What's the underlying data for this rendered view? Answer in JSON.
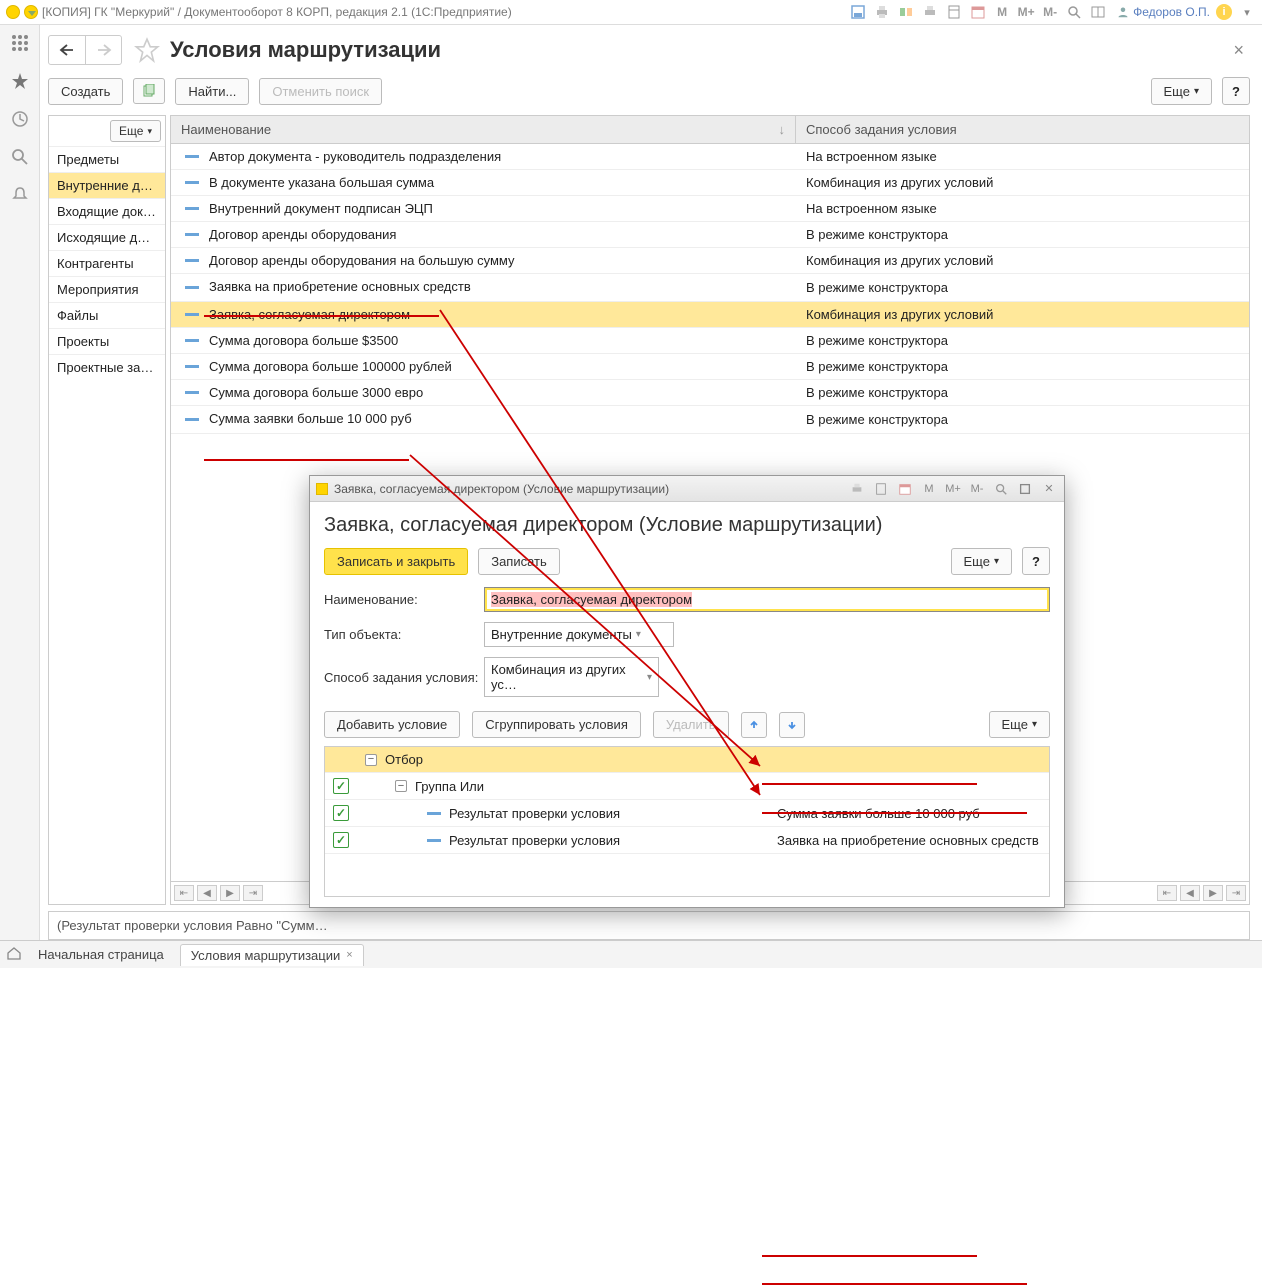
{
  "titlebar": {
    "text": "[КОПИЯ] ГК \"Меркурий\" / Документооборот 8 КОРП, редакция 2.1   (1С:Предприятие)",
    "user": "Федоров О.П.",
    "m_labels": [
      "M",
      "M+",
      "M-"
    ]
  },
  "page": {
    "title": "Условия маршрутизации",
    "create_btn": "Создать",
    "find_btn": "Найти...",
    "cancel_search_btn": "Отменить поиск",
    "more_btn": "Еще",
    "side_more": "Еще"
  },
  "sidebar": {
    "items": [
      {
        "label": "Предметы"
      },
      {
        "label": "Внутренние докум…",
        "selected": true
      },
      {
        "label": "Входящие докуме…"
      },
      {
        "label": "Исходящие докум…"
      },
      {
        "label": "Контрагенты"
      },
      {
        "label": "Мероприятия"
      },
      {
        "label": "Файлы"
      },
      {
        "label": "Проекты"
      },
      {
        "label": "Проектные задачи"
      }
    ]
  },
  "table": {
    "col_name": "Наименование",
    "col_type": "Способ задания условия",
    "rows": [
      {
        "name": "Автор документа - руководитель подразделения",
        "type": "На встроенном языке"
      },
      {
        "name": "В документе указана большая сумма",
        "type": "Комбинация из других условий"
      },
      {
        "name": "Внутренний документ подписан ЭЦП",
        "type": "На встроенном языке"
      },
      {
        "name": "Договор аренды оборудования",
        "type": "В режиме конструктора"
      },
      {
        "name": "Договор аренды оборудования на большую сумму",
        "type": "Комбинация из других условий"
      },
      {
        "name": "Заявка на приобретение основных средств",
        "type": "В режиме конструктора",
        "underline": true
      },
      {
        "name": "Заявка, согласуемая директором",
        "type": "Комбинация из других условий",
        "selected": true
      },
      {
        "name": "Сумма договора больше $3500",
        "type": "В режиме конструктора"
      },
      {
        "name": "Сумма договора больше 100000 рублей",
        "type": "В режиме конструктора"
      },
      {
        "name": "Сумма договора больше 3000 евро",
        "type": "В режиме конструктора"
      },
      {
        "name": "Сумма заявки больше 10 000 руб",
        "type": "В режиме конструктора",
        "underline": true
      }
    ]
  },
  "result_bar": "(Результат проверки условия Равно \"Сумм…",
  "tabs": {
    "home": "Начальная страница",
    "active": "Условия маршрутизации"
  },
  "dialog": {
    "title": "Заявка, согласуемая директором (Условие маршрутизации)",
    "header": "Заявка, согласуемая директором (Условие маршрутизации)",
    "save_close": "Записать и закрыть",
    "save": "Записать",
    "more": "Еще",
    "form": {
      "name_lbl": "Наименование:",
      "name_val": "Заявка, согласуемая директором",
      "type_lbl": "Тип объекта:",
      "type_val": "Внутренние документы",
      "mode_lbl": "Способ задания условия:",
      "mode_val": "Комбинация из других ус…"
    },
    "bar2": {
      "add": "Добавить условие",
      "group": "Сгруппировать условия",
      "delete": "Удалить",
      "more": "Еще"
    },
    "tree": {
      "root": "Отбор",
      "group": "Группа Или",
      "leaf_lbl": "Результат проверки условия",
      "leaf1_val": "Сумма заявки больше 10 000 руб",
      "leaf2_val": "Заявка на приобретение основных средств"
    },
    "m_labels": [
      "M",
      "M+",
      "M-"
    ]
  }
}
